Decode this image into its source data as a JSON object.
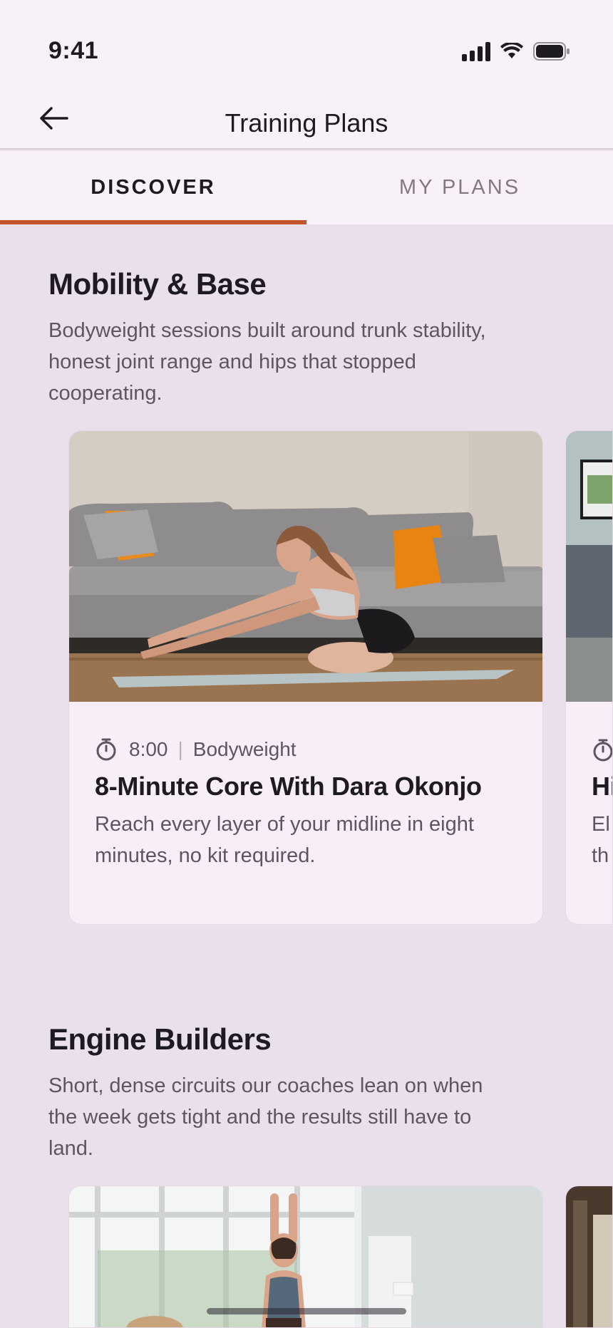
{
  "status_bar": {
    "time": "9:41"
  },
  "header": {
    "title": "Training Plans"
  },
  "tabs": [
    {
      "label": "DISCOVER",
      "active": true
    },
    {
      "label": "MY PLANS",
      "active": false
    }
  ],
  "accent_color": "#C3532A",
  "sections": [
    {
      "title": "Mobility & Base",
      "description": "Bodyweight sessions built around trunk stability, honest joint range and hips that stopped cooperating.",
      "cards": [
        {
          "duration": "8:00",
          "equipment": "Bodyweight",
          "title": "8-Minute Core With Dara Okonjo",
          "description": "Reach every layer of your midline in eight minutes, no kit required."
        },
        {
          "duration": "",
          "equipment": "",
          "title": "Hi",
          "description": "El th"
        }
      ]
    },
    {
      "title": "Engine Builders",
      "description": "Short, dense circuits our coaches lean on when the week gets tight and the results still have to land.",
      "cards": []
    }
  ]
}
